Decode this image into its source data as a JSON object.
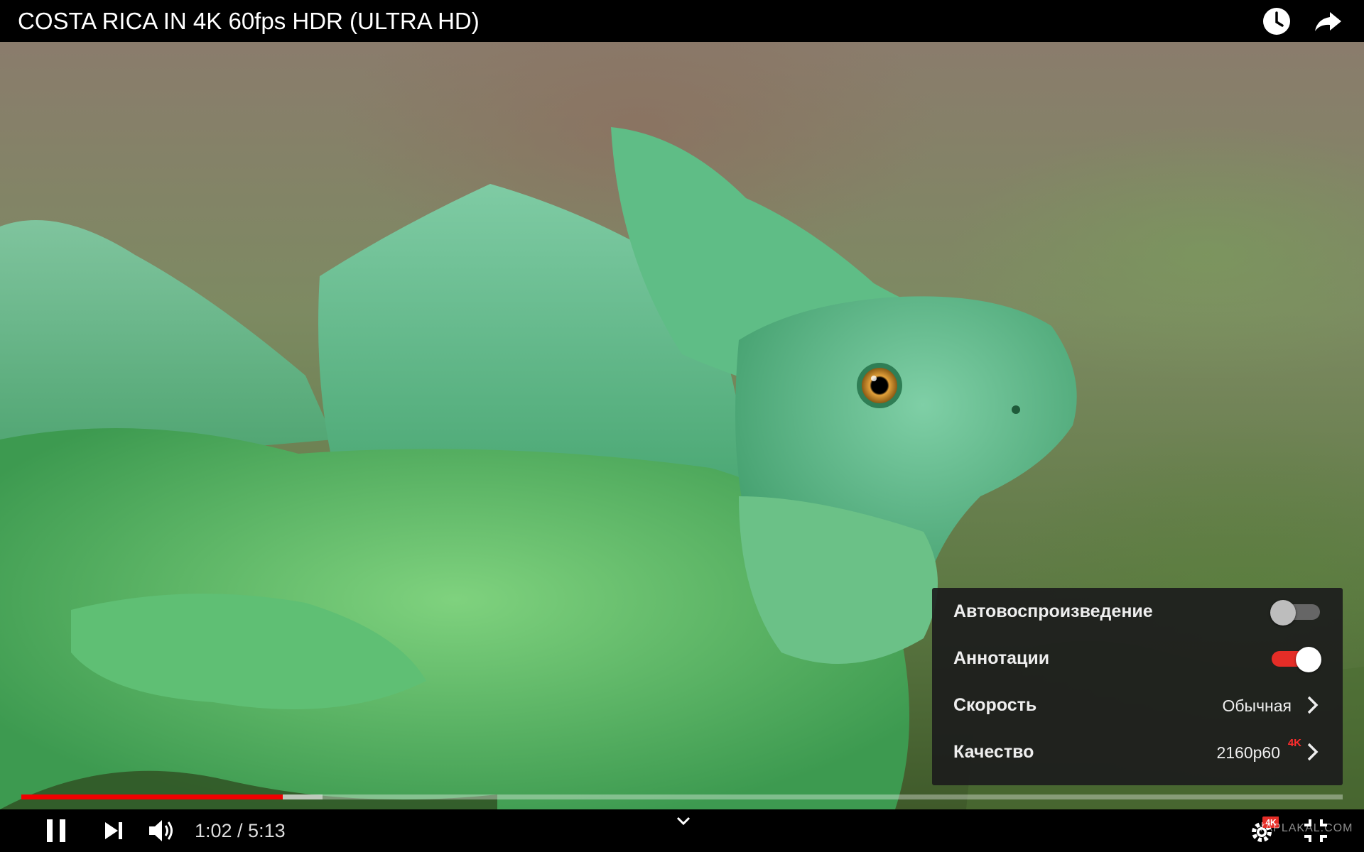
{
  "header": {
    "title": "COSTA RICA IN 4K 60fps HDR (ULTRA HD)",
    "watch_later_icon": "clock-icon",
    "share_icon": "share-arrow-icon"
  },
  "settings_menu": {
    "rows": [
      {
        "label": "Автовоспроизведение",
        "control": "toggle",
        "state": "off"
      },
      {
        "label": "Аннотации",
        "control": "toggle",
        "state": "on"
      },
      {
        "label": "Скорость",
        "value": "Обычная",
        "control": "submenu"
      },
      {
        "label": "Качество",
        "value": "2160p60",
        "badge": "4K",
        "control": "submenu"
      }
    ]
  },
  "player": {
    "current_time": "1:02",
    "duration": "5:13",
    "time_display": "1:02 / 5:13",
    "progress_played_fraction": 0.198,
    "progress_buffered_fraction": 0.228,
    "settings_badge": "4K",
    "watermark": "YAPLAKAL.COM"
  },
  "colors": {
    "accent_red": "#f00000",
    "toggle_on_track": "#e52d27",
    "toggle_off_track": "#666666",
    "menu_background": "#1c1c1c"
  },
  "icons": [
    "pause-icon",
    "next-icon",
    "volume-icon",
    "chevron-down-icon",
    "gear-icon",
    "fullscreen-exit-icon"
  ]
}
